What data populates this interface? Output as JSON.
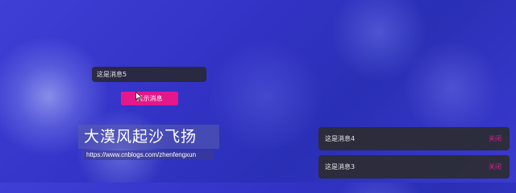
{
  "input": {
    "value": "这是消息5"
  },
  "button": {
    "label": "显示消息"
  },
  "watermark": {
    "title": "大漠风起沙飞扬",
    "url": "https://www.cnblogs.com/zhenfengxun"
  },
  "toasts": [
    {
      "message": "这是消息4",
      "action": "关闭"
    },
    {
      "message": "这是消息3",
      "action": "关闭"
    }
  ],
  "colors": {
    "accent": "#e4178c",
    "toast_bg": "#2c2c32",
    "background": "#3434c8"
  }
}
